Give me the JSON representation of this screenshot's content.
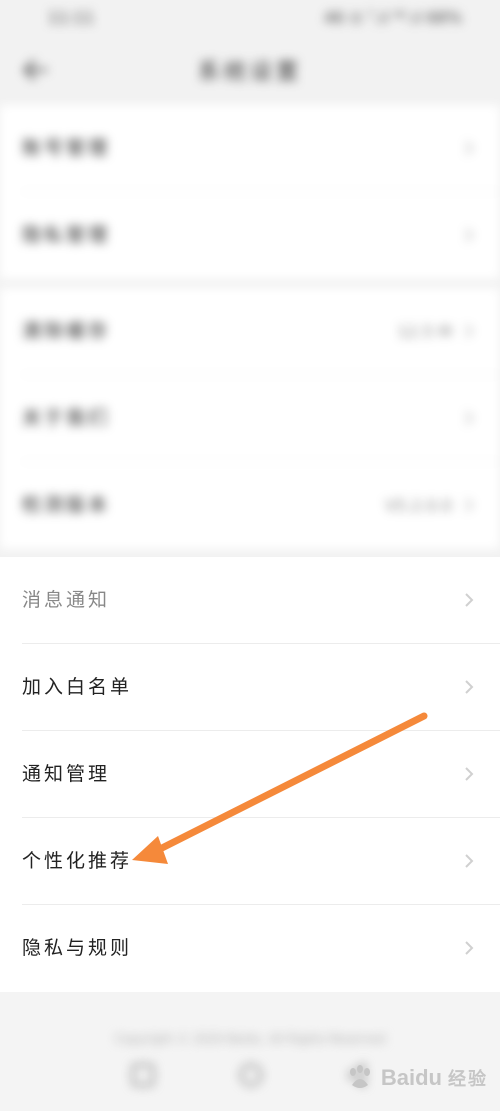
{
  "status_bar": {
    "time": "11:11",
    "indicators": "46 ⊙ ᵀ.ıl ⁴ᴳ.ıl 68%"
  },
  "nav": {
    "title": "系统设置",
    "back_icon": "back-arrow-icon"
  },
  "group1": [
    {
      "label": "账号管理",
      "value": ""
    },
    {
      "label": "隐私管理",
      "value": ""
    }
  ],
  "group2": [
    {
      "label": "清除缓存",
      "value": "12.5 M"
    },
    {
      "label": "关于我们",
      "value": ""
    },
    {
      "label": "检测版本",
      "value": "V5.2.0.0"
    }
  ],
  "group3": [
    {
      "label": "消息通知",
      "value": ""
    },
    {
      "label": "加入白名单",
      "value": ""
    },
    {
      "label": "通知管理",
      "value": ""
    },
    {
      "label": "个性化推荐",
      "value": ""
    },
    {
      "label": "隐私与规则",
      "value": ""
    }
  ],
  "footer": {
    "text": "Copyright © 2020 Baidu. All Rights Reserved"
  },
  "watermark": {
    "brand": "Baidu",
    "sub": "经验"
  },
  "colors": {
    "arrow": "#f5893a",
    "background": "#f2f2f2",
    "row_bg": "#ffffff"
  }
}
